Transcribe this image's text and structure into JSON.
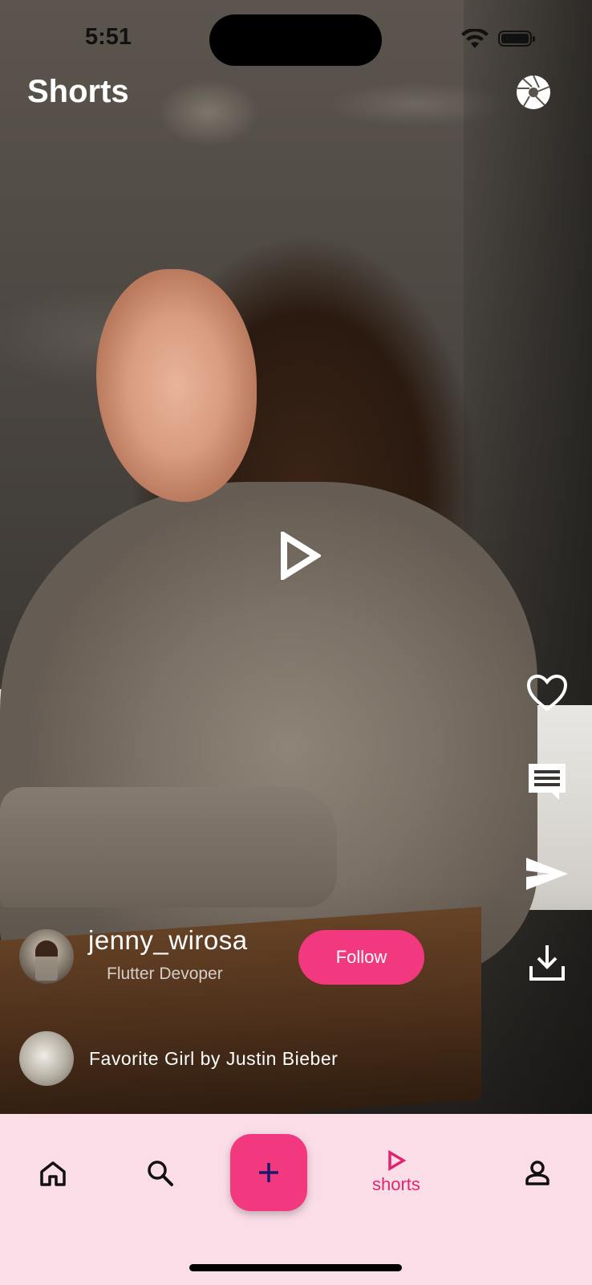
{
  "status_bar": {
    "time": "5:51"
  },
  "header": {
    "title": "Shorts"
  },
  "creator": {
    "username": "jenny_wirosa",
    "subtitle": "Flutter Devoper",
    "follow_label": "Follow"
  },
  "music": {
    "title": "Favorite Girl by Justin Bieber"
  },
  "bottom_nav": {
    "items": [
      {
        "icon": "home-icon",
        "label": ""
      },
      {
        "icon": "search-icon",
        "label": ""
      },
      {
        "icon": "add-icon",
        "label": ""
      },
      {
        "icon": "play-outline-icon",
        "label": "shorts"
      },
      {
        "icon": "profile-icon",
        "label": ""
      }
    ],
    "active_index": 3
  },
  "colors": {
    "accent": "#f2397f",
    "nav_background": "#fbdde8",
    "active_label": "#e0256f"
  }
}
